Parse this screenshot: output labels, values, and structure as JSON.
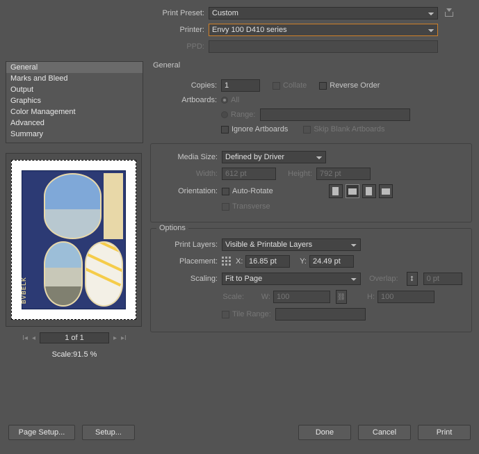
{
  "top": {
    "print_preset_label": "Print Preset:",
    "print_preset_value": "Custom",
    "printer_label": "Printer:",
    "printer_value": "Envy 100 D410 series",
    "ppd_label": "PPD:",
    "ppd_value": ""
  },
  "categories": {
    "items": [
      "General",
      "Marks and Bleed",
      "Output",
      "Graphics",
      "Color Management",
      "Advanced",
      "Summary"
    ],
    "selected": "General"
  },
  "preview": {
    "page_indicator": "1 of 1",
    "scale_text": "Scale:91.5 %"
  },
  "general": {
    "title": "General",
    "copies_label": "Copies:",
    "copies_value": "1",
    "collate_label": "Collate",
    "reverse_order_label": "Reverse Order",
    "artboards_label": "Artboards:",
    "all_label": "All",
    "range_label": "Range:",
    "range_value": "",
    "ignore_artboards_label": "Ignore Artboards",
    "skip_blank_label": "Skip Blank Artboards"
  },
  "media": {
    "title": "Media Size:",
    "size_value": "Defined by Driver",
    "width_label": "Width:",
    "width_value": "612 pt",
    "height_label": "Height:",
    "height_value": "792 pt",
    "orientation_label": "Orientation:",
    "auto_rotate_label": "Auto-Rotate",
    "transverse_label": "Transverse"
  },
  "options": {
    "title": "Options",
    "print_layers_label": "Print Layers:",
    "print_layers_value": "Visible & Printable Layers",
    "placement_label": "Placement:",
    "x_label": "X:",
    "x_value": "16.85 pt",
    "y_label": "Y:",
    "y_value": "24.49 pt",
    "scaling_label": "Scaling:",
    "scaling_value": "Fit to Page",
    "overlap_label": "Overlap:",
    "overlap_value": "0 pt",
    "scale_label": "Scale:",
    "w_label": "W:",
    "w_value": "100",
    "h_label": "H:",
    "h_value": "100",
    "tile_range_label": "Tile Range:",
    "tile_range_value": ""
  },
  "footer": {
    "page_setup": "Page Setup...",
    "setup": "Setup...",
    "done": "Done",
    "cancel": "Cancel",
    "print": "Print"
  }
}
